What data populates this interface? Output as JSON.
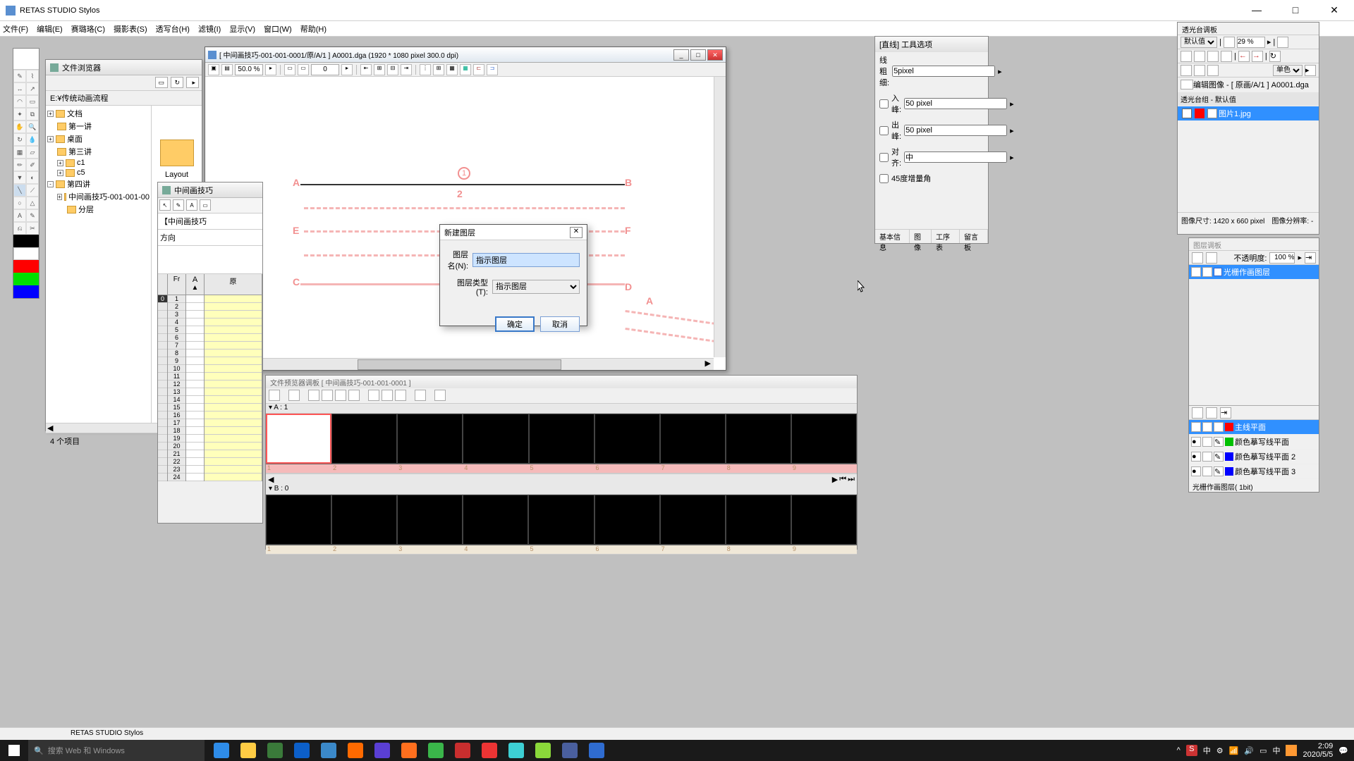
{
  "app": {
    "title": "RETAS STUDIO Stylos"
  },
  "menu": [
    "文件(F)",
    "编辑(E)",
    "赛璐珞(C)",
    "摄影表(S)",
    "透写台(H)",
    "滤镜(I)",
    "显示(V)",
    "窗口(W)",
    "帮助(H)"
  ],
  "toolbox": {
    "colors": [
      "#000000",
      "#ffffff",
      "#ff0000",
      "#00e000",
      "#0000ff"
    ]
  },
  "file_browser": {
    "title": "文件浏览器",
    "path": "E:¥传统动画流程",
    "tree": [
      {
        "label": "文档",
        "indent": 0,
        "exp": "+"
      },
      {
        "label": "第一讲",
        "indent": 1,
        "exp": ""
      },
      {
        "label": "桌面",
        "indent": 0,
        "exp": "+"
      },
      {
        "label": "第三讲",
        "indent": 1,
        "exp": ""
      },
      {
        "label": "c1",
        "indent": 1,
        "exp": "+"
      },
      {
        "label": "c5",
        "indent": 1,
        "exp": "+"
      },
      {
        "label": "第四讲",
        "indent": 0,
        "exp": "-"
      },
      {
        "label": "中间画技巧-001-001-00",
        "indent": 1,
        "exp": "+"
      },
      {
        "label": "分层",
        "indent": 2,
        "exp": ""
      }
    ],
    "view_item": "Layout",
    "footer": "4 个项目"
  },
  "canvas": {
    "title": "[ 中间画技巧-001-001-0001/原/A/1 ] A0001.dga (1920 * 1080 pixel 300.0 dpi)",
    "zoom": "50.0 %",
    "frame": "0",
    "labels": {
      "A": "A",
      "B": "B",
      "C": "C",
      "D": "D",
      "E": "E",
      "F": "F",
      "n1": "1",
      "n2": "2"
    }
  },
  "xsheet": {
    "title": "中间画技巧",
    "header_text": "【中间画技巧",
    "header_text2": "方向",
    "col_fr": "Fr",
    "col_a": "A",
    "frames": [
      "1",
      "2",
      "3",
      "4",
      "5",
      "6",
      "7",
      "8",
      "9",
      "10",
      "11",
      "12",
      "13",
      "14",
      "15",
      "16",
      "17",
      "18",
      "19",
      "20",
      "21",
      "22",
      "23",
      "24"
    ]
  },
  "timeline": {
    "title": "文件预览器调板 [ 中间画技巧-001-001-0001 ]",
    "track_a": "▾ A : 1",
    "track_b": "▾ B : 0",
    "ruler": [
      "1",
      "2",
      "3",
      "4",
      "5",
      "6",
      "7",
      "8",
      "9"
    ]
  },
  "tool_opts": {
    "title": "[直线] 工具选项",
    "line_width_label": "线粗细:",
    "line_width": "5pixel",
    "in_label": "入峰:",
    "in_val": "50 pixel",
    "out_label": "出峰:",
    "out_val": "50 pixel",
    "align_label": "对齐:",
    "align_val": "中",
    "angle45": "45度增量角",
    "tabs": [
      "基本信息",
      "图像",
      "工序表",
      "留言板"
    ]
  },
  "lighttable": {
    "title": "透光台调板",
    "preset": "默认值",
    "zoom": "29 %",
    "mode": "单色",
    "edit_label": "编辑图像 - [ 原画/A/1 ] A0001.dga",
    "group_label": "透光台组 - 默认值",
    "item": "图片1.jpg",
    "footer": "图像尺寸: 1420 x 660 pixel　图像分辨率: -"
  },
  "layers": {
    "title": "图层调板",
    "opacity_label": "不透明度:",
    "opacity": "100 %",
    "layer1": "光栅作画图层",
    "planes": [
      "主线平面",
      "颜色摹写线平面",
      "颜色摹写线平面 2",
      "颜色摹写线平面 3"
    ],
    "plane_colors": [
      "#ff0000",
      "#00c000",
      "#0000ff",
      "#0000ff"
    ],
    "footer": "光栅作画图层( 1bit)"
  },
  "dialog": {
    "title": "新建图层",
    "name_label": "图层名(N):",
    "name_value": "指示图层",
    "type_label": "图层类型(T):",
    "type_value": "指示图层",
    "ok": "确定",
    "cancel": "取消"
  },
  "statusbar": "RETAS STUDIO Stylos",
  "taskbar": {
    "search": "搜索 Web 和 Windows",
    "tray_text": "中",
    "time": "2:09",
    "date": "2020/5/5",
    "app_colors": [
      "#2e8ce8",
      "#ffcc44",
      "#3a7a3a",
      "#0c5fc9",
      "#3b89c9",
      "#ff6a00",
      "#5a3fd4",
      "#ff6f1e",
      "#3ab54a",
      "#c92e2e",
      "#ec3434",
      "#3dcfd3",
      "#8ad83a",
      "#4a5f9e",
      "#2f6cd0"
    ]
  }
}
